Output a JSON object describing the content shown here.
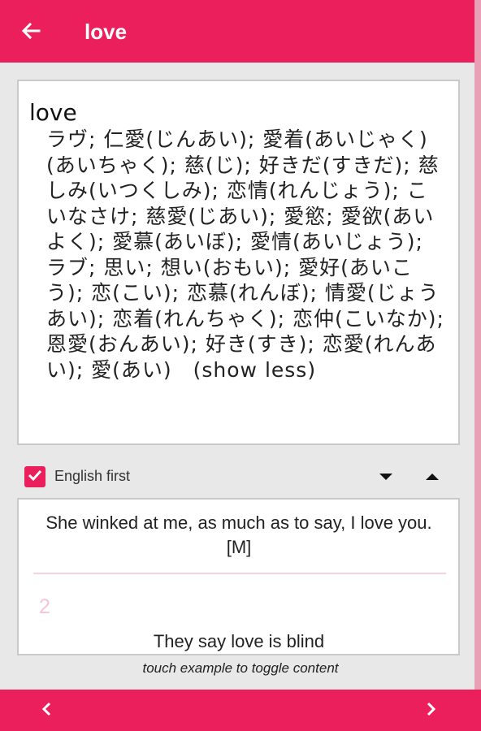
{
  "appbar": {
    "title": "love",
    "icons": {
      "back": "arrow-left-icon"
    }
  },
  "definition": {
    "word": "love",
    "text": "ラヴ; 仁愛(じんあい); 愛着(あいじゃく)(あいちゃく); 慈(じ); 好きだ(すきだ); 慈しみ(いつくしみ); 恋情(れんじょう); こいなさけ; 慈愛(じあい); 愛慾; 愛欲(あいよく); 愛慕(あいぼ); 愛情(あいじょう); ラブ; 思い; 想い(おもい); 愛好(あいこう); 恋(こい); 恋慕(れんぼ); 情愛(じょうあい); 恋着(れんちゃく); 恋仲(こいなか); 恩愛(おんあい); 好き(すき); 恋愛(れんあい); 愛(あい)　(show less)"
  },
  "options": {
    "english_first_label": "English first",
    "english_first_checked": true,
    "icons": {
      "down": "triangle-down-icon",
      "up": "triangle-up-icon"
    }
  },
  "examples": {
    "current_text": "She winked at me, as much as to say, I love you. [M]",
    "next_number": "2",
    "next_text": "They say love is blind"
  },
  "hint": "touch example to toggle content",
  "bottom_nav": {
    "icons": {
      "prev": "chevron-left-icon",
      "next": "chevron-right-icon"
    }
  },
  "colors": {
    "accent": "#ea1f5c",
    "divider": "#f8d3df",
    "muted_number": "#f6c6d4",
    "background": "#e8e8e8"
  }
}
